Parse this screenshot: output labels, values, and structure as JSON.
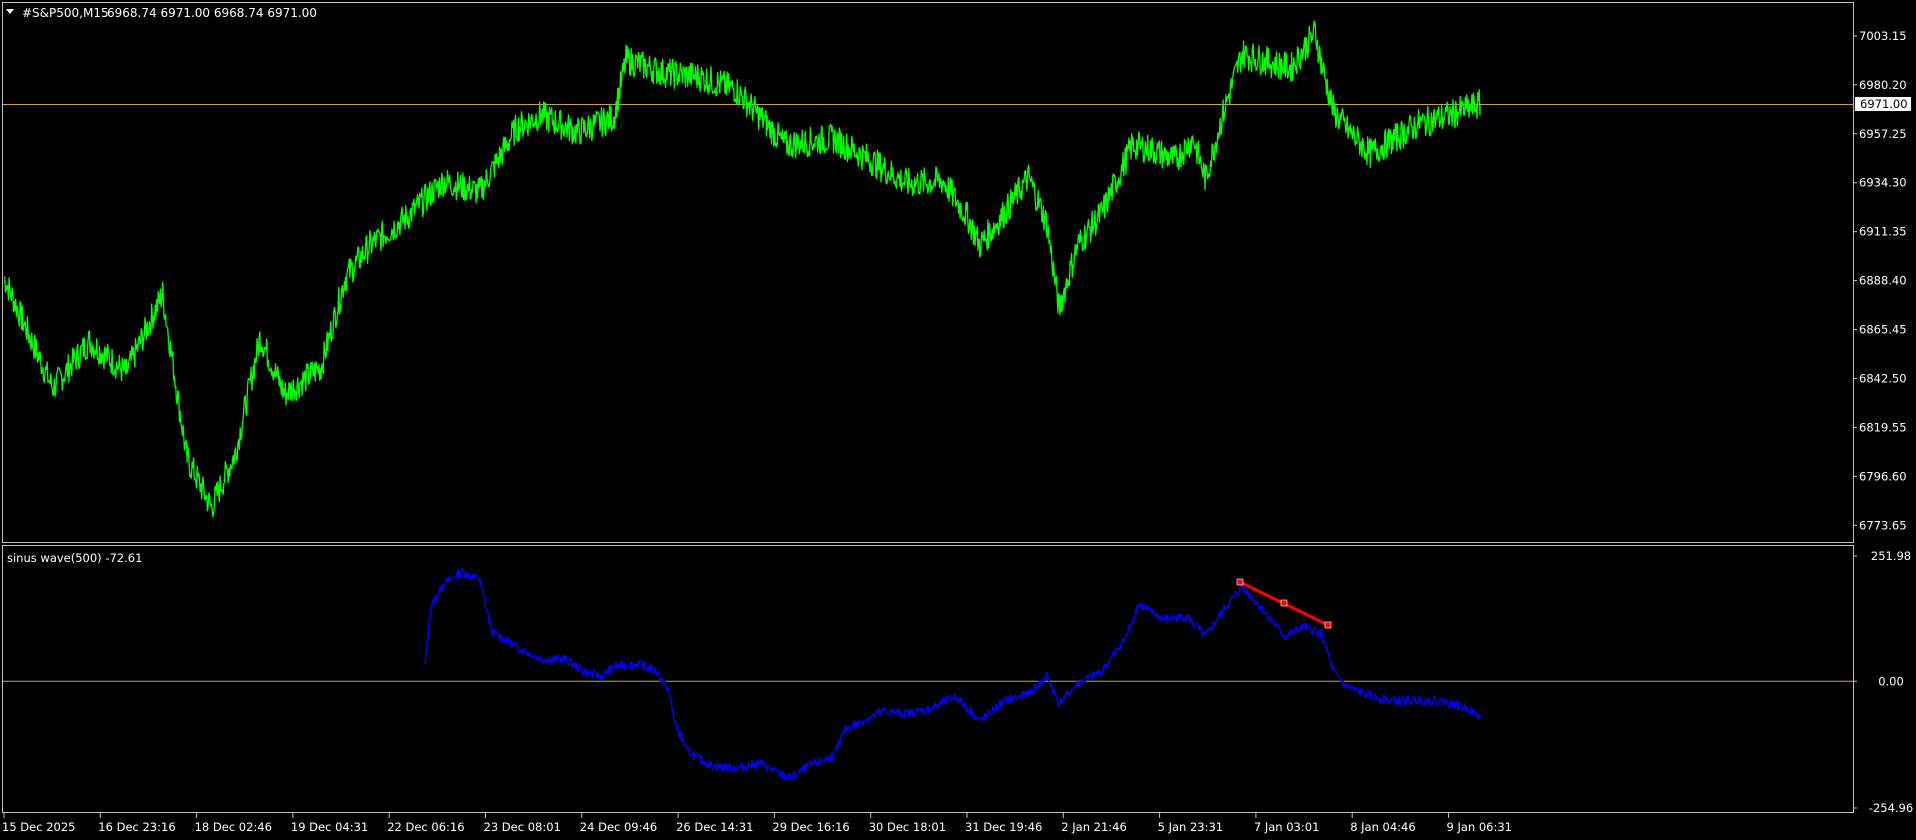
{
  "header": {
    "menu_icon": "triangle-down-icon",
    "symbol_timeframe": "#S&P500,M15",
    "ohlc": "6968.74 6971.00 6968.74 6971.00"
  },
  "current_price_label": "6971.00",
  "indicator": {
    "label": "sinus wave(500)  -72.61"
  },
  "time_axis_labels": [
    "15 Dec 2025",
    "16 Dec 23:16",
    "18 Dec 02:46",
    "19 Dec 04:31",
    "22 Dec 06:16",
    "23 Dec 08:01",
    "24 Dec 09:46",
    "26 Dec 14:31",
    "29 Dec 16:16",
    "30 Dec 18:01",
    "31 Dec 19:46",
    "2 Jan 21:46",
    "5 Jan 23:31",
    "7 Jan 03:01",
    "8 Jan 04:46",
    "9 Jan 06:31"
  ],
  "colors": {
    "price_line": "#00ff00",
    "indicator_line": "#0000ff",
    "trendline": "#ff0000",
    "level_line": "#c8a050",
    "frame": "#c0c0c0"
  },
  "chart_data": [
    {
      "type": "line",
      "name": "price",
      "x": [
        0,
        15,
        40,
        70,
        100,
        130,
        150,
        170,
        190,
        210,
        230,
        260,
        280,
        300,
        330,
        360,
        390,
        420,
        440,
        470,
        500,
        510,
        540,
        570,
        600,
        625,
        640,
        680,
        710,
        740,
        770,
        790,
        800,
        820,
        840,
        855,
        865,
        880,
        900,
        925,
        940,
        960,
        975,
        985,
        1000,
        1015,
        1030,
        1055,
        1075,
        1080,
        1090,
        1100,
        1120,
        1140,
        1160,
        1180,
        1210
      ],
      "values": [
        6890,
        6870,
        6838,
        6860,
        6845,
        6882,
        6805,
        6782,
        6808,
        6862,
        6835,
        6848,
        6890,
        6905,
        6918,
        6935,
        6930,
        6960,
        6966,
        6958,
        6965,
        6992,
        6986,
        6984,
        6978,
        6962,
        6952,
        6955,
        6945,
        6934,
        6935,
        6918,
        6905,
        6920,
        6937,
        6915,
        6875,
        6905,
        6920,
        6952,
        6950,
        6945,
        6955,
        6936,
        6968,
        6995,
        6992,
        6988,
        7005,
        6990,
        6968,
        6960,
        6948,
        6955,
        6962,
        6965,
        6971
      ],
      "ytick_labels": [
        "7003.15",
        "6980.20",
        "6957.25",
        "6934.30",
        "6911.35",
        "6888.40",
        "6865.45",
        "6842.50",
        "6819.55",
        "6796.60",
        "6773.65"
      ],
      "ylim": [
        6766.76,
        7018.1
      ]
    },
    {
      "type": "line",
      "name": "sinus wave(500)",
      "x": [
        345,
        350,
        360,
        375,
        390,
        400,
        420,
        440,
        460,
        475,
        490,
        500,
        520,
        535,
        545,
        550,
        560,
        580,
        600,
        620,
        635,
        645,
        660,
        680,
        690,
        700,
        720,
        740,
        760,
        780,
        800,
        820,
        840,
        855,
        865,
        880,
        900,
        920,
        930,
        950,
        970,
        985,
        1000,
        1015,
        1030,
        1050,
        1065,
        1080,
        1090,
        1100,
        1120,
        1140,
        1160,
        1180,
        1200,
        1210
      ],
      "values": [
        30,
        150,
        195,
        220,
        205,
        100,
        70,
        45,
        45,
        20,
        10,
        30,
        35,
        20,
        -20,
        -85,
        -140,
        -170,
        -175,
        -165,
        -185,
        -195,
        -170,
        -150,
        -95,
        -85,
        -60,
        -65,
        -55,
        -30,
        -80,
        -40,
        -25,
        10,
        -45,
        -5,
        20,
        90,
        155,
        125,
        130,
        90,
        145,
        190,
        150,
        90,
        110,
        95,
        20,
        -10,
        -30,
        -40,
        -38,
        -40,
        -55,
        -72.61
      ],
      "ytick_labels": [
        "251.98",
        "0.00",
        "-254.96"
      ],
      "ylim": [
        -254.96,
        251.98
      ]
    }
  ]
}
